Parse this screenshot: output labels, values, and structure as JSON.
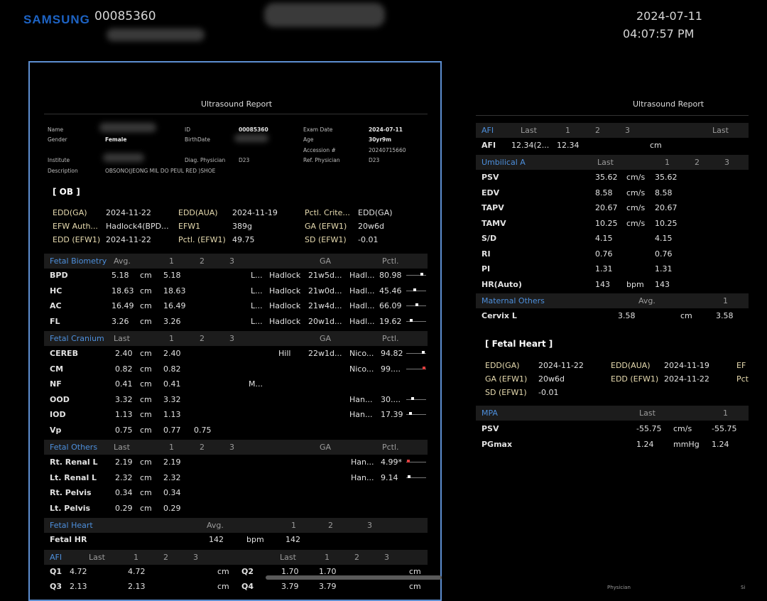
{
  "header": {
    "brand": "SAMSUNG",
    "patient_id": "00085360",
    "date": "2024-07-11",
    "time": "04:07:57 PM"
  },
  "left": {
    "title": "Ultrasound Report",
    "info": {
      "name_label": "Name",
      "gender_label": "Gender",
      "gender_value": "Female",
      "id_label": "ID",
      "id_value": "00085360",
      "birth_label": "BirthDate",
      "exam_label": "Exam Date",
      "exam_value": "2024-07-11",
      "age_label": "Age",
      "age_value": "30yr9m",
      "acc_label": "Accession #",
      "acc_value": "20240715660",
      "institute_label": "Institute",
      "diag_label": "Diag. Physician",
      "diag_value": "D23",
      "ref_label": "Ref. Physician",
      "ref_value": "D23",
      "desc_label": "Description",
      "desc_value": "OBSONO(JEONG MIL DO PEUL RED )SHOE"
    },
    "ob": {
      "title": "[ OB ]",
      "rows": [
        [
          "EDD(GA)",
          "2024-11-22",
          "EDD(AUA)",
          "2024-11-19",
          "Pctl. Crite...",
          "EDD(GA)"
        ],
        [
          "EFW Auth...",
          "Hadlock4(BPD...",
          "EFW1",
          "389g",
          "GA (EFW1)",
          "20w6d"
        ],
        [
          "EDD (EFW1)",
          "2024-11-22",
          "Pctl. (EFW1)",
          "49.75",
          "SD (EFW1)",
          "-0.01"
        ]
      ]
    },
    "biometry": {
      "title": "Fetal Biometry",
      "cols": [
        "Avg.",
        "1",
        "2",
        "3",
        "GA",
        "Pctl."
      ],
      "rows": [
        {
          "label": "BPD",
          "avg": "5.18",
          "unit": "cm",
          "v1": "5.18",
          "l": "L...",
          "auth": "Hadlock",
          "ga": "21w5d...",
          "pa": "Hadl...",
          "pct": "80.98",
          "mark": 0.85,
          "red": false
        },
        {
          "label": "HC",
          "avg": "18.63",
          "unit": "cm",
          "v1": "18.63",
          "l": "L...",
          "auth": "Hadlock",
          "ga": "21w0d...",
          "pa": "Hadl...",
          "pct": "45.46",
          "mark": 0.4,
          "red": false
        },
        {
          "label": "AC",
          "avg": "16.49",
          "unit": "cm",
          "v1": "16.49",
          "l": "L...",
          "auth": "Hadlock",
          "ga": "21w4d...",
          "pa": "Hadl...",
          "pct": "66.09",
          "mark": 0.55,
          "red": false
        },
        {
          "label": "FL",
          "avg": "3.26",
          "unit": "cm",
          "v1": "3.26",
          "l": "L...",
          "auth": "Hadlock",
          "ga": "20w1d...",
          "pa": "Hadl...",
          "pct": "19.62",
          "mark": 0.2,
          "red": false
        }
      ]
    },
    "cranium": {
      "title": "Fetal Cranium",
      "cols": [
        "Last",
        "1",
        "2",
        "3",
        "GA",
        "Pctl."
      ],
      "rows": [
        {
          "label": "CEREB",
          "last": "2.40",
          "unit": "cm",
          "v1": "2.40",
          "v2": "",
          "extra": "",
          "auth": "Hill",
          "ga": "22w1d...",
          "pa": "Nico...",
          "pct": "94.82",
          "mark": 0.9,
          "red": false
        },
        {
          "label": "CM",
          "last": "0.82",
          "unit": "cm",
          "v1": "0.82",
          "v2": "",
          "extra": "",
          "auth": "",
          "ga": "",
          "pa": "Nico...",
          "pct": "99....",
          "mark": 0.95,
          "red": true
        },
        {
          "label": "NF",
          "last": "0.41",
          "unit": "cm",
          "v1": "0.41",
          "v2": "",
          "extra": "M...",
          "auth": "",
          "ga": "",
          "pa": "",
          "pct": "",
          "mark": null,
          "red": false
        },
        {
          "label": "OOD",
          "last": "3.32",
          "unit": "cm",
          "v1": "3.32",
          "v2": "",
          "extra": "",
          "auth": "",
          "ga": "",
          "pa": "Han...",
          "pct": "30....",
          "mark": 0.3,
          "red": false
        },
        {
          "label": "IOD",
          "last": "1.13",
          "unit": "cm",
          "v1": "1.13",
          "v2": "",
          "extra": "",
          "auth": "",
          "ga": "",
          "pa": "Han...",
          "pct": "17.39",
          "mark": 0.18,
          "red": false
        },
        {
          "label": "Vp",
          "last": "0.75",
          "unit": "cm",
          "v1": "0.77",
          "v2": "0.75",
          "extra": "",
          "auth": "",
          "ga": "",
          "pa": "",
          "pct": "",
          "mark": null,
          "red": false
        }
      ]
    },
    "others": {
      "title": "Fetal Others",
      "cols": [
        "Last",
        "1",
        "2",
        "3",
        "GA",
        "Pctl."
      ],
      "rows": [
        {
          "label": "Rt. Renal L",
          "last": "2.19",
          "unit": "cm",
          "v1": "2.19",
          "pa": "Han...",
          "pct": "4.99*",
          "mark": 0.05,
          "red": true
        },
        {
          "label": "Lt. Renal L",
          "last": "2.32",
          "unit": "cm",
          "v1": "2.32",
          "pa": "Han...",
          "pct": "9.14",
          "mark": 0.1,
          "red": false
        },
        {
          "label": "Rt. Pelvis",
          "last": "0.34",
          "unit": "cm",
          "v1": "0.34",
          "pa": "",
          "pct": "",
          "mark": null,
          "red": false
        },
        {
          "label": "Lt. Pelvis",
          "last": "0.29",
          "unit": "cm",
          "v1": "0.29",
          "pa": "",
          "pct": "",
          "mark": null,
          "red": false
        }
      ]
    },
    "heart": {
      "title": "Fetal Heart",
      "cols": [
        "Avg.",
        "1",
        "2",
        "3"
      ],
      "row": {
        "label": "Fetal HR",
        "avg": "142",
        "unit": "bpm",
        "v1": "142"
      }
    },
    "afi": {
      "title": "AFI",
      "cols": [
        "Last",
        "1",
        "2",
        "3",
        "Last",
        "1",
        "2",
        "3"
      ],
      "rows": [
        [
          "Q1",
          "4.72",
          "4.72",
          "cm",
          "Q2",
          "1.70",
          "1.70",
          "cm"
        ],
        [
          "Q3",
          "2.13",
          "2.13",
          "cm",
          "Q4",
          "3.79",
          "3.79",
          "cm"
        ]
      ]
    }
  },
  "right": {
    "title": "Ultrasound Report",
    "afi": {
      "title": "AFI",
      "cols": [
        "Last",
        "1",
        "2",
        "3",
        "Last"
      ],
      "row": {
        "label": "AFI",
        "last": "12.34(2...",
        "v1": "12.34",
        "unit": "cm"
      }
    },
    "umbilical": {
      "title": "Umbilical A",
      "cols": [
        "Last",
        "1",
        "2",
        "3"
      ],
      "rows": [
        {
          "label": "PSV",
          "last": "35.62",
          "unit": "cm/s",
          "v1": "35.62"
        },
        {
          "label": "EDV",
          "last": "8.58",
          "unit": "cm/s",
          "v1": "8.58"
        },
        {
          "label": "TAPV",
          "last": "20.67",
          "unit": "cm/s",
          "v1": "20.67"
        },
        {
          "label": "TAMV",
          "last": "10.25",
          "unit": "cm/s",
          "v1": "10.25"
        },
        {
          "label": "S/D",
          "last": "4.15",
          "unit": "",
          "v1": "4.15"
        },
        {
          "label": "RI",
          "last": "0.76",
          "unit": "",
          "v1": "0.76"
        },
        {
          "label": "PI",
          "last": "1.31",
          "unit": "",
          "v1": "1.31"
        },
        {
          "label": "HR(Auto)",
          "last": "143",
          "unit": "bpm",
          "v1": "143"
        }
      ]
    },
    "maternal": {
      "title": "Maternal Others",
      "cols": [
        "Avg.",
        "1"
      ],
      "row": {
        "label": "Cervix L",
        "avg": "3.58",
        "unit": "cm",
        "v1": "3.58"
      }
    },
    "fetal_heart": {
      "title": "[ Fetal Heart ]",
      "rows": [
        [
          "EDD(GA)",
          "2024-11-22",
          "EDD(AUA)",
          "2024-11-19",
          "EF"
        ],
        [
          "GA (EFW1)",
          "20w6d",
          "EDD (EFW1)",
          "2024-11-22",
          "Pct"
        ],
        [
          "SD (EFW1)",
          "-0.01",
          "",
          "",
          ""
        ]
      ]
    },
    "mpa": {
      "title": "MPA",
      "cols": [
        "Last",
        "1"
      ],
      "rows": [
        {
          "label": "PSV",
          "last": "-55.75",
          "unit": "cm/s",
          "v1": "-55.75"
        },
        {
          "label": "PGmax",
          "last": "1.24",
          "unit": "mmHg",
          "v1": "1.24"
        }
      ]
    },
    "footer": [
      "Physician",
      "Si"
    ]
  }
}
